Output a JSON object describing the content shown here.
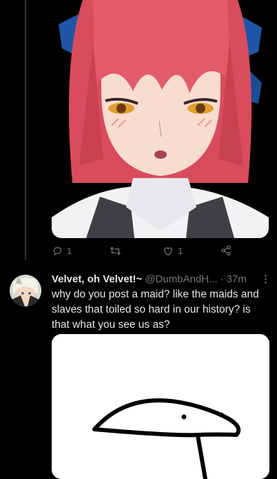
{
  "top_tweet": {
    "image_alt": "anime girl with red hair and blue ribbons",
    "actions": {
      "reply_count": "1",
      "retweet_count": "",
      "like_count": "1"
    }
  },
  "reply_tweet": {
    "display_name": "Velvet, oh Velvet!~",
    "handle": "@DumbAndH...",
    "separator": "·",
    "time": "37m",
    "more": "⋮",
    "text": "why do you post a maid? like the maids and slaves that toiled so hard in our history? is that what you see us as?"
  },
  "colors": {
    "background": "#000000",
    "text": "#e7e9ea",
    "muted": "#71767b",
    "thread_line": "#333639"
  }
}
